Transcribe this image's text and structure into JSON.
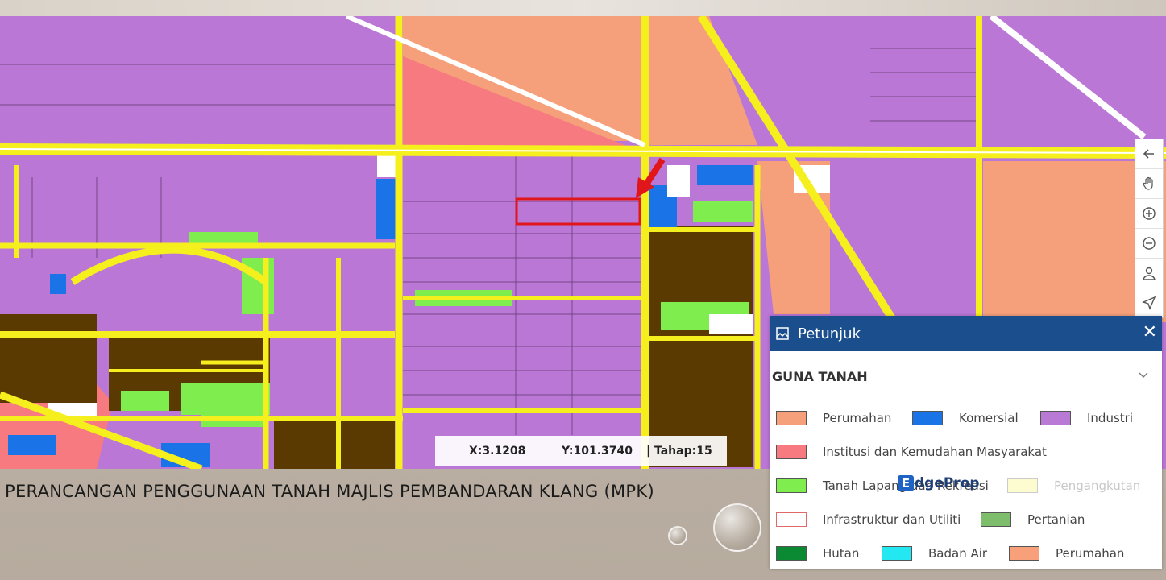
{
  "caption": "PERANCANGAN PENGGUNAAN TANAH MAJLIS PEMBANDARAN KLANG (MPK)",
  "coordinates": {
    "x": "X:3.1208",
    "y": "Y:101.3740",
    "level": "| Tahap:15"
  },
  "toolbar": {
    "tools": [
      "back-arrow-icon",
      "pan-hand-icon",
      "zoom-in-icon",
      "zoom-out-icon",
      "person-icon",
      "navigate-icon"
    ]
  },
  "legend": {
    "title": "Petunjuk",
    "close": "✕",
    "section": "GUNA TANAH",
    "items": [
      {
        "label": "Perumahan",
        "color": "#f5a07a"
      },
      {
        "label": "Komersial",
        "color": "#1a74e8"
      },
      {
        "label": "Industri",
        "color": "#b97ad6"
      },
      {
        "label": "Institusi dan Kemudahan Masyarakat",
        "color": "#f77a80"
      },
      {
        "label": "Tanah Lapang dan Rekreasi",
        "color": "#7fed4e"
      },
      {
        "label": "Pengangkutan",
        "color": "#fdfbd0"
      },
      {
        "label": "Infrastruktur dan Utiliti",
        "color": "#ffffff"
      },
      {
        "label": "Pertanian",
        "color": "#7dbd6c"
      },
      {
        "label": "Hutan",
        "color": "#0b8a33"
      },
      {
        "label": "Badan Air",
        "color": "#23e8f2"
      },
      {
        "label": "Perumahan",
        "color": "#f7a07a"
      }
    ]
  },
  "watermark": {
    "mark": "E",
    "text": "dgeProp"
  },
  "colors": {
    "industri": "#bb77d6",
    "perumahan": "#f5a07a",
    "institusi": "#f77a80",
    "komersial": "#1a74e8",
    "tanah_lapang": "#7fed4e",
    "road": "#f6ef1e",
    "subject_outline": "#e0161b",
    "legend_header": "#1a4e8c"
  }
}
